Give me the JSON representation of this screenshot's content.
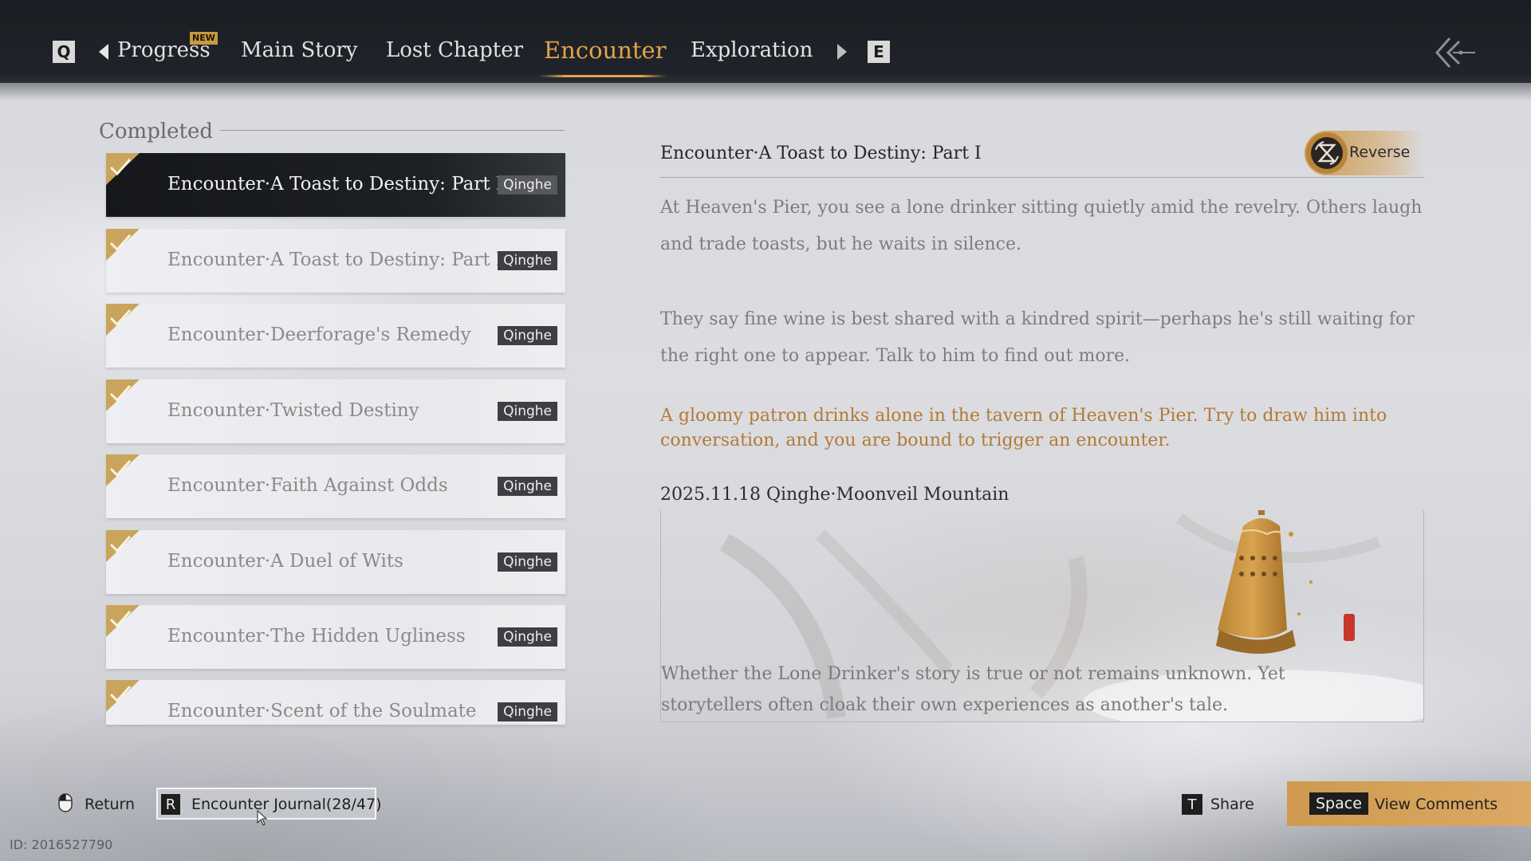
{
  "nav": {
    "left_key": "Q",
    "right_key": "E",
    "new_badge": "NEW",
    "tabs": [
      {
        "label": "Progress",
        "active": false
      },
      {
        "label": "Main Story",
        "active": false
      },
      {
        "label": "Lost Chapter",
        "active": false
      },
      {
        "label": "Encounter",
        "active": true
      },
      {
        "label": "Exploration",
        "active": false
      }
    ],
    "back_icon": "double-chevron-left-arrow-icon"
  },
  "list": {
    "section_title": "Completed",
    "items": [
      {
        "title": "Encounter·A Toast to Destiny: Part I",
        "tag": "Qinghe",
        "selected": true
      },
      {
        "title": "Encounter·A Toast to Destiny: Part II",
        "tag": "Qinghe",
        "selected": false
      },
      {
        "title": "Encounter·Deerforage's Remedy",
        "tag": "Qinghe",
        "selected": false
      },
      {
        "title": "Encounter·Twisted Destiny",
        "tag": "Qinghe",
        "selected": false
      },
      {
        "title": "Encounter·Faith Against Odds",
        "tag": "Qinghe",
        "selected": false
      },
      {
        "title": "Encounter·A Duel of Wits",
        "tag": "Qinghe",
        "selected": false
      },
      {
        "title": "Encounter·The Hidden Ugliness",
        "tag": "Qinghe",
        "selected": false
      },
      {
        "title": "Encounter·Scent of the Soulmate",
        "tag": "Qinghe",
        "selected": false
      }
    ]
  },
  "detail": {
    "title": "Encounter·A Toast to Destiny: Part I",
    "reverse_label": "Reverse",
    "paragraph1": "At Heaven's Pier, you see a lone drinker sitting quietly amid the revelry. Others laugh and trade toasts, but he waits in silence.",
    "paragraph2": "They say fine wine is best shared with a kindred spirit—perhaps he's still waiting for the right one to appear. Talk to him to find out more.",
    "hint": "A gloomy patron drinks alone in the tavern of Heaven's Pier. Try to draw him into conversation, and you are bound to trigger an encounter.",
    "date_location": "2025.11.18 Qinghe·Moonveil Mountain",
    "card_text": "Whether the Lone Drinker's story is true or not remains unknown. Yet storytellers often cloak their own experiences as another's tale."
  },
  "footer": {
    "return_label": "Return",
    "journal_key": "R",
    "journal_label": "Encounter Journal(28/47)",
    "share_key": "T",
    "share_label": "Share",
    "comments_key": "Space",
    "comments_label": "View Comments",
    "uid": "ID: 2016527790"
  },
  "colors": {
    "accent": "#e3a24a",
    "hint_text": "#b27a36",
    "topbar": "#1c1f24",
    "button_gold": "#d3a057"
  }
}
